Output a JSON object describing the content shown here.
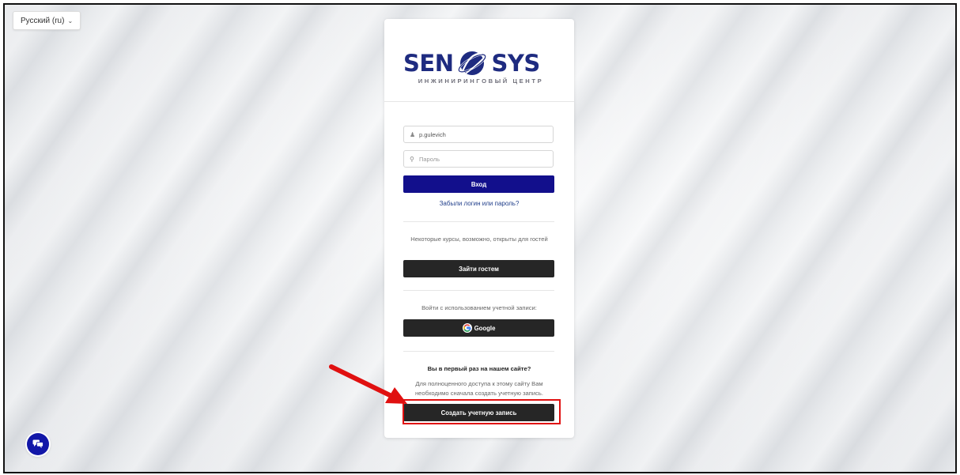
{
  "language": {
    "label": "Русский (ru)"
  },
  "logo": {
    "left_word": "SEN",
    "right_word": "SYS",
    "tagline": "ИНЖИНИРИНГОВЫЙ ЦЕНТР"
  },
  "login": {
    "username_value": "p.gulevich",
    "password_placeholder": "Пароль",
    "submit_label": "Вход",
    "forgot_link": "Забыли логин или пароль?"
  },
  "guest": {
    "note": "Некоторые курсы, возможно, открыты для гостей",
    "button_label": "Зайти гостем"
  },
  "oauth": {
    "note": "Войти с использованием учетной записи:",
    "google_label": "Google"
  },
  "signup": {
    "heading": "Вы в первый раз на нашем сайте?",
    "note": "Для полноценного доступа к этому сайту Вам необходимо сначала создать учетную запись.",
    "button_label": "Создать учетную запись"
  },
  "colors": {
    "brand": "#1e2b80",
    "primary_button": "#120f8c",
    "dark_button": "#262626",
    "annotation": "#e01010",
    "chat": "#1217a8"
  },
  "icons": [
    "user-icon",
    "key-icon",
    "google-icon",
    "chat-icon",
    "chevron-down-icon"
  ]
}
